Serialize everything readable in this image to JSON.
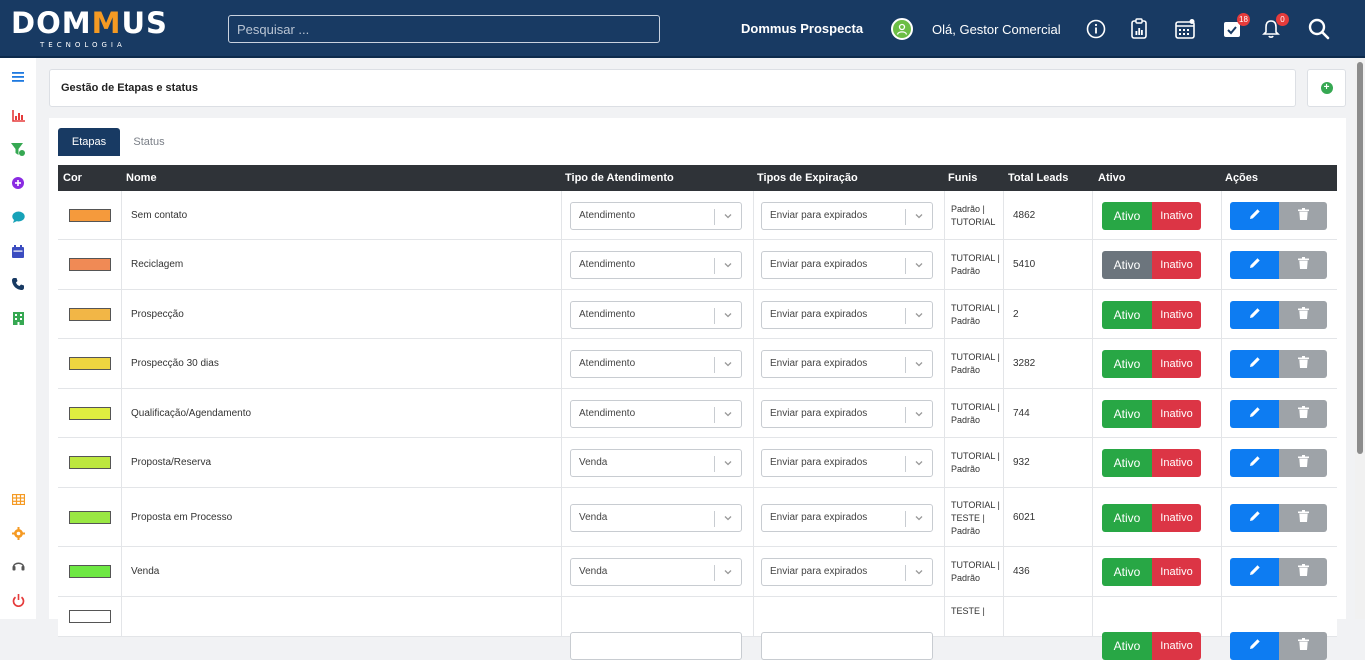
{
  "brand": {
    "logo_pre": "DOM",
    "logo_accent": "M",
    "logo_post": "US",
    "logo_sub": "TECNOLOGIA"
  },
  "topbar": {
    "search_placeholder": "Pesquisar ...",
    "app_name": "Dommus Prospecta",
    "greeting": "Olá, Gestor Comercial",
    "icons": [
      "info-icon",
      "clipboard-chart-icon",
      "calendar-icon",
      "task-check-icon",
      "bell-icon",
      "search-icon"
    ],
    "task_badge": "18",
    "bell_badge": "0"
  },
  "sidebar": {
    "icons": [
      "menu-icon",
      "chart-icon",
      "funnel-icon",
      "plus-circle-icon",
      "chat-icon",
      "calendar-icon",
      "phone-icon",
      "building-icon",
      "table-icon",
      "gear-icon",
      "headset-icon",
      "power-icon"
    ],
    "colors": [
      "#1f7ae0",
      "#e53b3b",
      "#36a852",
      "#8a2be2",
      "#17a2b8",
      "#3b4cc0",
      "#183a63",
      "#36a852",
      "#f59a23",
      "#f59a23",
      "#555555",
      "#e53b3b"
    ]
  },
  "page": {
    "title": "Gestão de Etapas e status",
    "add_icon": "plus-circle-icon"
  },
  "tabs": [
    {
      "label": "Etapas",
      "active": true
    },
    {
      "label": "Status",
      "active": false
    }
  ],
  "table": {
    "headers": {
      "cor": "Cor",
      "nome": "Nome",
      "tipo_atendimento": "Tipo de Atendimento",
      "tipos_expiracao": "Tipos de Expiração",
      "funis": "Funis",
      "total_leads": "Total Leads",
      "ativo": "Ativo",
      "acoes": "Ações"
    },
    "ativo_label": "Ativo",
    "inativo_label": "Inativo",
    "rows": [
      {
        "color": "#f59a3c",
        "nome": "Sem contato",
        "tipo": "Atendimento",
        "expiracao": "Enviar para expirados",
        "funis": "Padrão | TUTORIAL",
        "leads": "4862",
        "ativo": true
      },
      {
        "color": "#f08a55",
        "nome": "Reciclagem",
        "tipo": "Atendimento",
        "expiracao": "Enviar para expirados",
        "funis": "TUTORIAL | Padrão",
        "leads": "5410",
        "ativo": false
      },
      {
        "color": "#f2b646",
        "nome": "Prospecção",
        "tipo": "Atendimento",
        "expiracao": "Enviar para expirados",
        "funis": "TUTORIAL | Padrão",
        "leads": "2",
        "ativo": true
      },
      {
        "color": "#eed540",
        "nome": "Prospecção 30 dias",
        "tipo": "Atendimento",
        "expiracao": "Enviar para expirados",
        "funis": "TUTORIAL | Padrão",
        "leads": "3282",
        "ativo": true
      },
      {
        "color": "#dfee40",
        "nome": "Qualificação/Agendamento",
        "tipo": "Atendimento",
        "expiracao": "Enviar para expirados",
        "funis": "TUTORIAL | Padrão",
        "leads": "744",
        "ativo": true
      },
      {
        "color": "#bde83f",
        "nome": "Proposta/Reserva",
        "tipo": "Venda",
        "expiracao": "Enviar para expirados",
        "funis": "TUTORIAL | Padrão",
        "leads": "932",
        "ativo": true
      },
      {
        "color": "#9ae843",
        "nome": "Proposta em Processo",
        "tipo": "Venda",
        "expiracao": "Enviar para expirados",
        "funis": "TUTORIAL | TESTE | Padrão",
        "leads": "6021",
        "ativo": true
      },
      {
        "color": "#6ee843",
        "nome": "Venda",
        "tipo": "Venda",
        "expiracao": "Enviar para expirados",
        "funis": "TUTORIAL | Padrão",
        "leads": "436",
        "ativo": true
      },
      {
        "color": "#ffffff",
        "nome": "",
        "tipo": "",
        "expiracao": "",
        "funis": "TESTE |",
        "leads": "",
        "ativo": true
      }
    ]
  },
  "colors": {
    "navy": "#183a63",
    "ativo_green": "#28a745",
    "ativo_off": "#6c757d",
    "inativo_red": "#dc3545",
    "edit_blue": "#0d7cf2",
    "delete_gray": "#9ea3a8"
  }
}
